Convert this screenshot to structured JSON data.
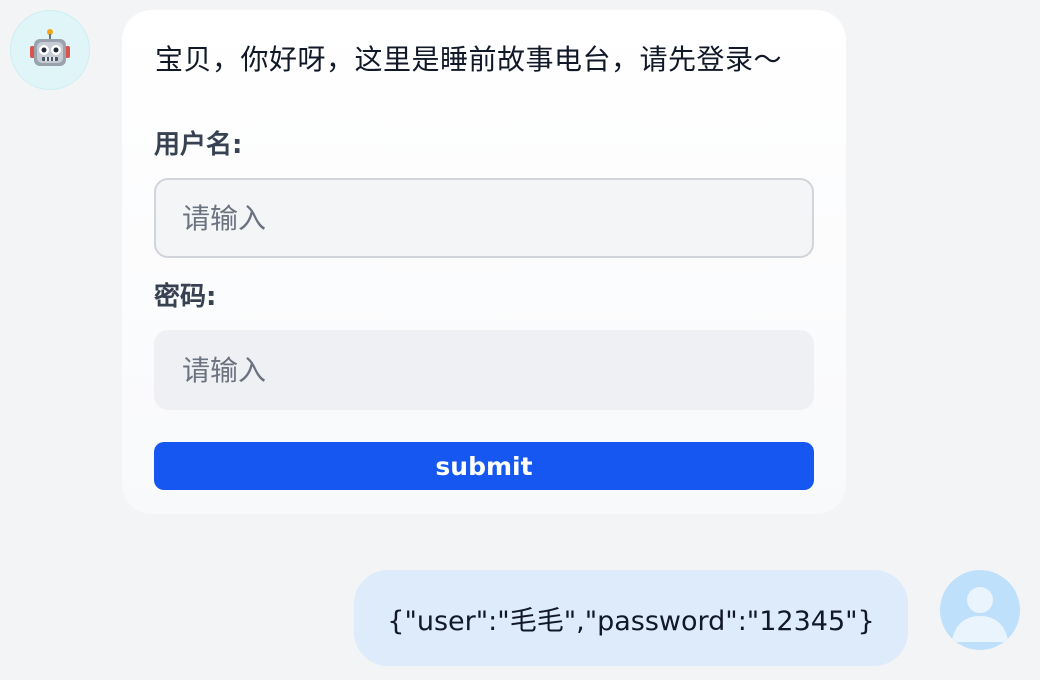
{
  "bot": {
    "avatar_icon": "robot-icon",
    "greeting": "宝贝，你好呀，这里是睡前故事电台，请先登录～"
  },
  "form": {
    "username_label": "用户名:",
    "username_placeholder": "请输入",
    "password_label": "密码:",
    "password_placeholder": "请输入",
    "submit_label": "submit"
  },
  "user": {
    "avatar_icon": "user-avatar-icon",
    "message": "{\"user\":\"毛毛\",\"password\":\"12345\"}"
  },
  "colors": {
    "background": "#f3f4f6",
    "submit_button": "#1557f0",
    "user_bubble": "#ddebfb",
    "bot_avatar_bg": "#dff5f7",
    "user_avatar_bg": "#bfe0fb"
  }
}
